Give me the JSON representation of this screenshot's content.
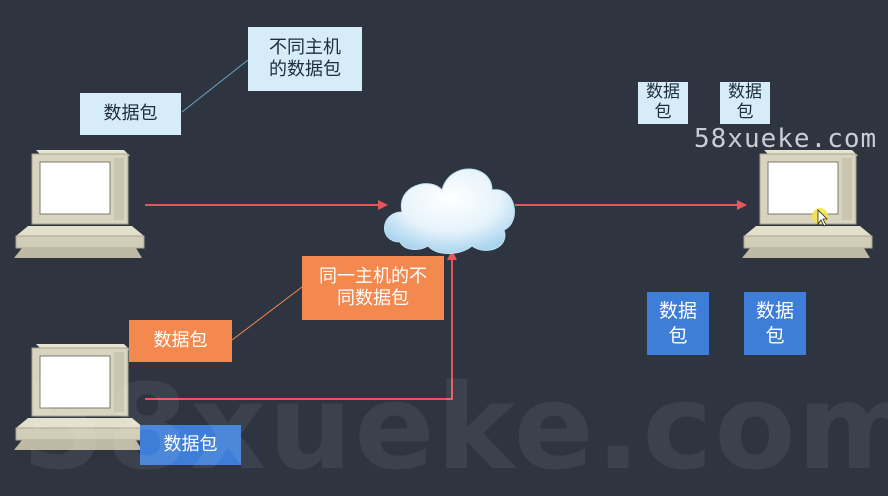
{
  "labels": {
    "different_host_note": "不同主机\n的数据包",
    "packet_top_left": "数据包",
    "packet_right_1": "数据\n包",
    "packet_right_2": "数据\n包",
    "same_host_note": "同一主机的不\n同数据包",
    "packet_orange": "数据包",
    "packet_bottom_blue": "数据包",
    "packet_right_blue_1": "数据\n包",
    "packet_right_blue_2": "数据\n包"
  },
  "watermarks": {
    "small": "58xueke.com",
    "large": "58xueke.com"
  },
  "colors": {
    "background": "#2e3440",
    "arrow": "#e8565b",
    "light_box": "#d6ecf8",
    "orange_box": "#f4894f",
    "blue_box": "#3f7ed8"
  }
}
